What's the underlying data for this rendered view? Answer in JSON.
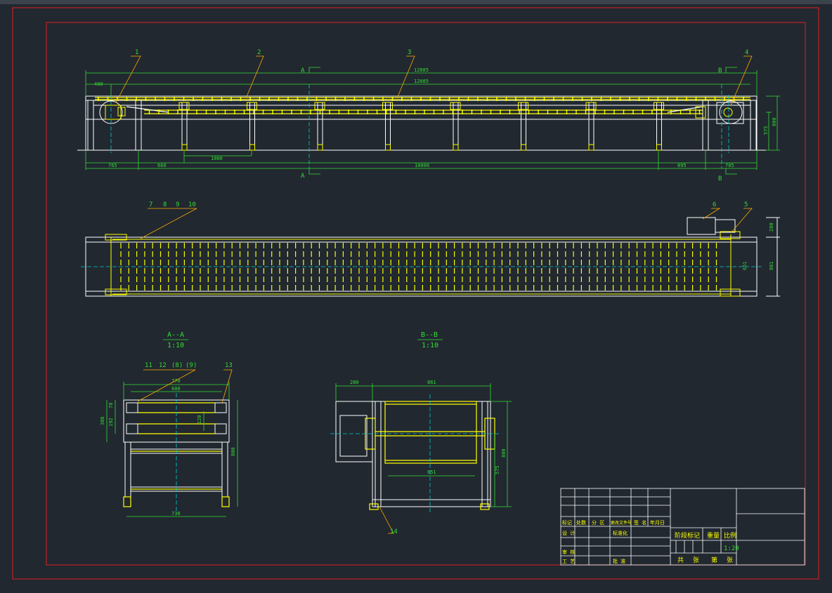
{
  "colors": {
    "background": "#212830",
    "frame_red": "#e02020",
    "outline_white": "#ffffff",
    "structure_yellow": "#ffff00",
    "dimension_green": "#33dd33",
    "leader_orange": "#ffaa00",
    "center_cyan": "#00cccc",
    "title_text": "#ffff00"
  },
  "balloons": [
    "1",
    "2",
    "3",
    "4",
    "5",
    "6",
    "7",
    "8",
    "9",
    "10",
    "11",
    "12",
    "(8)",
    "(9)",
    "13",
    "14"
  ],
  "section_marks": {
    "a_top": "A",
    "a_bottom": "A",
    "b_top": "B",
    "b_bottom": "B"
  },
  "front_view": {
    "dims": {
      "left_ext": "400",
      "overall": "12885",
      "inner": "12085",
      "bot_left": "765",
      "bot_660": "660",
      "bot_pitch": "1000",
      "bot_total": "10000",
      "bot_right": "895",
      "bot_end": "705",
      "right_575": "575",
      "right_800": "800"
    }
  },
  "plan_view": {
    "dims": {
      "right_280": "280",
      "right_861": "861",
      "inner_651": "651"
    }
  },
  "section_aa": {
    "title": "A--A",
    "scale": "1:10",
    "dims": {
      "w770": "770",
      "w600": "600",
      "h78": "78",
      "h192": "192",
      "h386": "386",
      "h120": "120",
      "h800": "800",
      "w730": "730"
    }
  },
  "section_bb": {
    "title": "B--B",
    "scale": "1:10",
    "dims": {
      "w280": "280",
      "w861": "861",
      "w651": "651",
      "h575": "575",
      "h800": "800"
    }
  },
  "title_block": {
    "row_labels": [
      "标记",
      "处数",
      "分 区",
      "更改文件号",
      "签 名",
      "年月日"
    ],
    "left_labels": [
      "设 计",
      "审 核",
      "工 艺"
    ],
    "mid_labels": [
      "标准化",
      "批 准"
    ],
    "stage_mark": "阶段标记",
    "weight": "重量",
    "ratio": "比例",
    "scale_value": "1:20",
    "total": "共",
    "sheets": "张",
    "sheet_no": "第",
    "sheet_unit": "张"
  }
}
